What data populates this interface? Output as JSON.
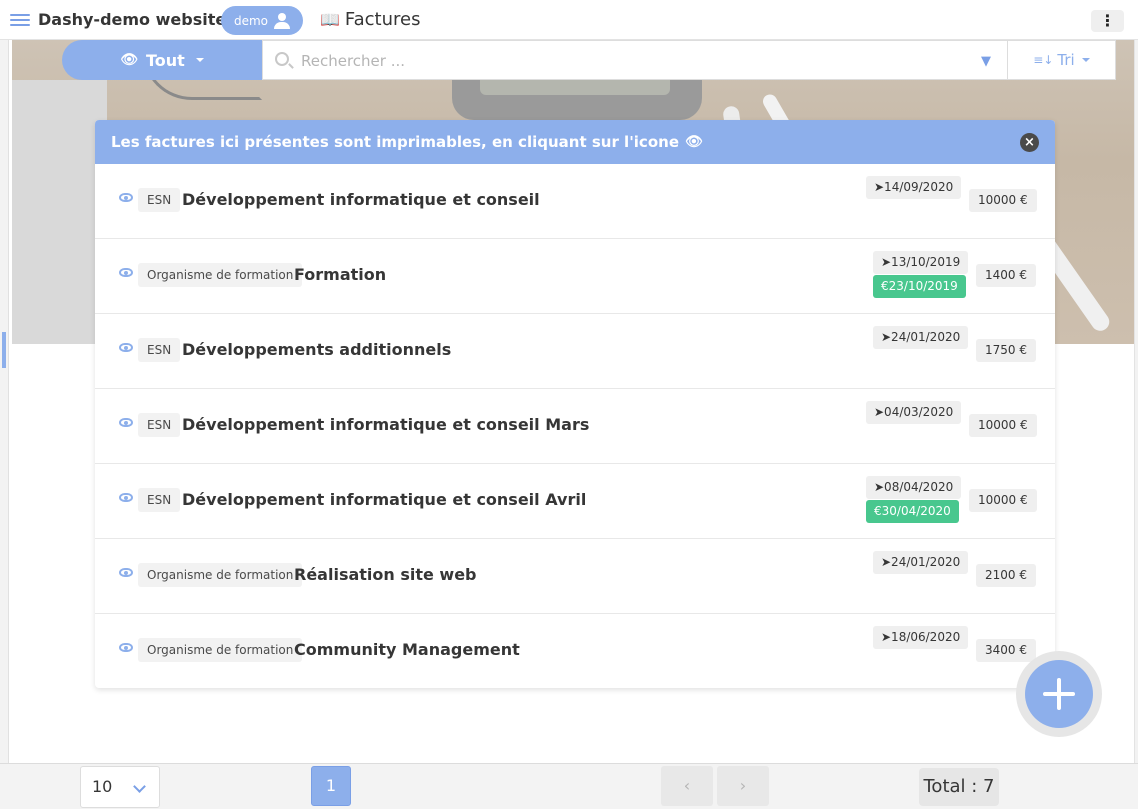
{
  "app": {
    "title": "Dashy-demo website",
    "user": "demo",
    "page_title": "Factures"
  },
  "filters": {
    "view_label": "Tout",
    "search_placeholder": "Rechercher ...",
    "sort_label": "Tri"
  },
  "notice": {
    "text": "Les factures ici présentes sont imprimables, en cliquant sur l'icone"
  },
  "invoices": [
    {
      "category": "ESN",
      "title": "Développement informatique et conseil",
      "sent": "➤14/09/2020",
      "paid": "",
      "amount": "10000 €"
    },
    {
      "category": "Organisme de formation",
      "title": "Formation",
      "sent": "➤13/10/2019",
      "paid": "€23/10/2019",
      "amount": "1400 €"
    },
    {
      "category": "ESN",
      "title": "Développements additionnels",
      "sent": "➤24/01/2020",
      "paid": "",
      "amount": "1750 €"
    },
    {
      "category": "ESN",
      "title": "Développement informatique et conseil Mars",
      "sent": "➤04/03/2020",
      "paid": "",
      "amount": "10000 €"
    },
    {
      "category": "ESN",
      "title": "Développement informatique et conseil Avril",
      "sent": "➤08/04/2020",
      "paid": "€30/04/2020",
      "amount": "10000 €"
    },
    {
      "category": "Organisme de formation",
      "title": "Réalisation site web",
      "sent": "➤24/01/2020",
      "paid": "",
      "amount": "2100 €"
    },
    {
      "category": "Organisme de formation",
      "title": "Community Management",
      "sent": "➤18/06/2020",
      "paid": "",
      "amount": "3400 €"
    }
  ],
  "pagination": {
    "page_size": "10",
    "current_page": "1",
    "prev": "‹",
    "next": "›",
    "total": "Total : 7"
  },
  "icons": {
    "menu": "hamburger-icon",
    "user": "user-icon",
    "book": "book-icon",
    "more": "kebab-icon",
    "eye": "eye-icon",
    "search": "search-icon",
    "filter": "filter-icon",
    "sort": "sort-icon",
    "close": "close-icon",
    "add": "plus-icon"
  },
  "colors": {
    "primary": "#8dafeb",
    "success": "#48c78e",
    "tag_bg": "#efefef"
  }
}
